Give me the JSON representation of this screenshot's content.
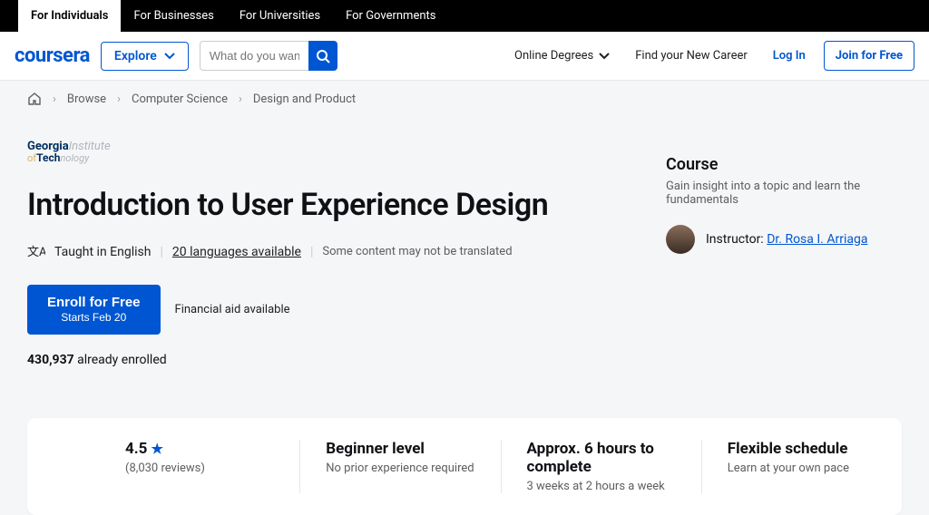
{
  "topbar": {
    "items": [
      "For Individuals",
      "For Businesses",
      "For Universities",
      "For Governments"
    ]
  },
  "header": {
    "logo": "coursera",
    "explore": "Explore",
    "search_placeholder": "What do you want to",
    "online_degrees": "Online Degrees",
    "find_career": "Find your New Career",
    "login": "Log In",
    "join": "Join for Free"
  },
  "breadcrumb": {
    "items": [
      "Browse",
      "Computer Science",
      "Design and Product"
    ]
  },
  "institution": {
    "line1a": "Georgia",
    "line1b": "Institute",
    "line2a": "of",
    "line2b": "Tech",
    "line2c": "nology"
  },
  "title": "Introduction to User Experience Design",
  "lang": {
    "taught": "Taught in English",
    "availLink": "20 languages available",
    "note": "Some content may not be translated"
  },
  "enroll": {
    "label": "Enroll for Free",
    "starts": "Starts Feb 20",
    "finaid": "Financial aid available"
  },
  "enrolled": {
    "count": "430,937",
    "text": " already enrolled"
  },
  "sidebar": {
    "heading": "Course",
    "sub": "Gain insight into a topic and learn the fundamentals",
    "instructor_label": "Instructor:",
    "instructor_name": "Dr. Rosa I. Arriaga"
  },
  "stats": {
    "rating": {
      "value": "4.5",
      "reviews": "(8,030 reviews)"
    },
    "level": {
      "title": "Beginner level",
      "sub": "No prior experience required"
    },
    "time": {
      "title": "Approx. 6 hours to complete",
      "sub": "3 weeks at 2 hours a week"
    },
    "schedule": {
      "title": "Flexible schedule",
      "sub": "Learn at your own pace"
    }
  }
}
